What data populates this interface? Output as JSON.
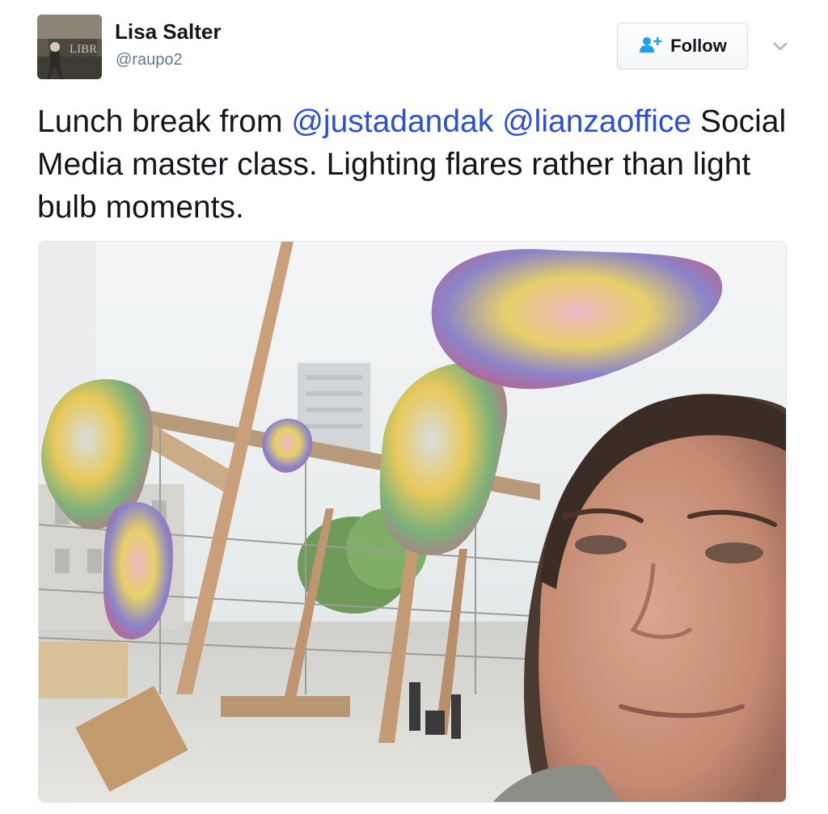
{
  "tweet": {
    "author": {
      "name": "Lisa Salter",
      "handle": "@raupo2",
      "avatar_sign_text": "LIBR"
    },
    "follow_button": {
      "label": "Follow",
      "icon": "add-user-icon"
    },
    "caret_icon": "chevron-down-icon",
    "text": {
      "prefix": "Lunch break from ",
      "mention_1": "@justadandak",
      "separator": " ",
      "mention_2": "@lianzaoffice",
      "suffix": " Social Media master class. Lighting flares rather than light bulb moments."
    },
    "photo": {
      "icon": "photo"
    }
  },
  "colors": {
    "link": "#2b4fd6",
    "follow_icon": "#1da1f2",
    "handle": "#657786"
  }
}
